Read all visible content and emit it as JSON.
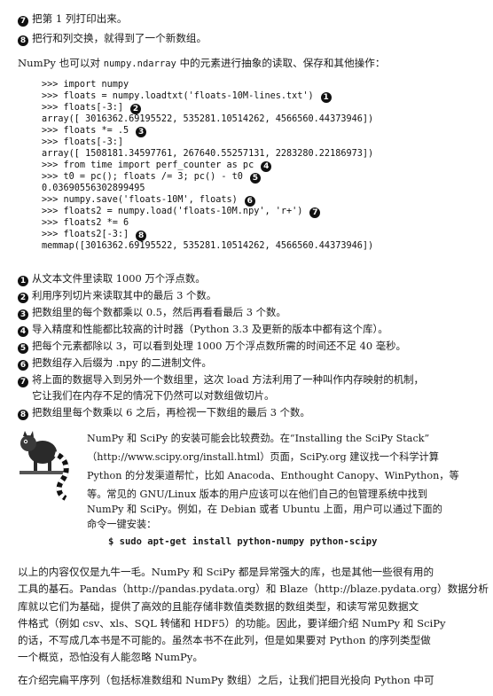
{
  "top_items": [
    {
      "marker": "7",
      "text": "把第 1 列打印出来。"
    },
    {
      "marker": "8",
      "text": "把行和列交换，就得到了一个新数组。"
    }
  ],
  "intro": {
    "before": "NumPy 也可以对 ",
    "code": "numpy.ndarray",
    "after": " 中的元素进行抽象的读取、保存和其他操作："
  },
  "code_lines": [
    {
      "text": ">>> import numpy",
      "marker": ""
    },
    {
      "text": ">>> floats = numpy.loadtxt('floats-10M-lines.txt')",
      "marker": "1"
    },
    {
      "text": ">>> floats[-3:]",
      "marker": "2"
    },
    {
      "text": "array([ 3016362.69195522,  535281.10514262, 4566560.44373946])",
      "marker": ""
    },
    {
      "text": ">>> floats *= .5",
      "marker": "3"
    },
    {
      "text": ">>> floats[-3:]",
      "marker": ""
    },
    {
      "text": "array([ 1508181.34597761,  267640.55257131, 2283280.22186973])",
      "marker": ""
    },
    {
      "text": ">>> from time import perf_counter as pc",
      "marker": "4"
    },
    {
      "text": ">>> t0 = pc(); floats /= 3; pc() - t0",
      "marker": "5"
    },
    {
      "text": "0.03690556302899495",
      "marker": ""
    },
    {
      "text": ">>> numpy.save('floats-10M', floats)",
      "marker": "6"
    },
    {
      "text": ">>> floats2 = numpy.load('floats-10M.npy', 'r+')",
      "marker": "7"
    },
    {
      "text": ">>> floats2 *= 6",
      "marker": ""
    },
    {
      "text": ">>> floats2[-3:]",
      "marker": "8"
    },
    {
      "text": "memmap([3016362.69195522,  535281.10514262, 4566560.44373946])",
      "marker": ""
    }
  ],
  "notes": [
    {
      "marker": "1",
      "lines": [
        "从文本文件里读取 1000 万个浮点数。"
      ]
    },
    {
      "marker": "2",
      "lines": [
        "利用序列切片来读取其中的最后 3 个数。"
      ]
    },
    {
      "marker": "3",
      "lines": [
        "把数组里的每个数都乘以 0.5，然后再看看最后 3 个数。"
      ]
    },
    {
      "marker": "4",
      "lines": [
        "导入精度和性能都比较高的计时器（Python 3.3 及更新的版本中都有这个库）。"
      ]
    },
    {
      "marker": "5",
      "lines": [
        "把每个元素都除以 3，可以看到处理 1000 万个浮点数所需的时间还不足 40 毫秒。"
      ]
    },
    {
      "marker": "6",
      "lines": [
        "把数组存入后缀为 .npy 的二进制文件。"
      ]
    },
    {
      "marker": "7",
      "lines": [
        "将上面的数据导入到另外一个数组里，这次 load 方法利用了一种叫作内存映射的机制，",
        "它让我们在内存不足的情况下仍然可以对数组做切片。"
      ]
    },
    {
      "marker": "8",
      "lines": [
        "把数组里每个数乘以 6 之后，再检视一下数组的最后 3 个数。"
      ]
    }
  ],
  "tip": {
    "icon": "ring-tailed-lemur-tip-icon",
    "lines": [
      "NumPy 和 SciPy 的安装可能会比较费劲。在“Installing the SciPy Stack”",
      "（http://www.scipy.org/install.html）页面，SciPy.org 建议找一个科学计算",
      "Python 的分发渠道帮忙，比如 Anacoda、Enthought Canopy、WinPython，等",
      "等。常见的 GNU/Linux 版本的用户应该可以在他们自己的包管理系统中找到",
      "NumPy 和 SciPy。例如，在 Debian 或者 Ubuntu 上面，用户可以通过下面的",
      "命令一键安装："
    ],
    "command": "$ sudo apt-get install python-numpy python-scipy"
  },
  "paragraph": [
    "以上的内容仅仅是九牛一毛。NumPy 和 SciPy 都是异常强大的库，也是其他一些很有用的",
    "工具的基石。Pandas（http://pandas.pydata.org）和 Blaze（http://blaze.pydata.org）数据分析",
    "库就以它们为基础，提供了高效的且能存储非数值类数据的数组类型，和读写常见数据文",
    "件格式（例如 csv、xls、SQL 转储和 HDF5）的功能。因此，要详细介绍 NumPy 和 SciPy",
    "的话，不写成几本书是不可能的。虽然本书不在此列，但是如果要对 Python 的序列类型做",
    "一个概览，恐怕没有人能忽略 NumPy。"
  ],
  "last_line": "在介绍完扁平序列（包括标准数组和 NumPy 数组）之后，让我们把目光投向 Python 中可"
}
